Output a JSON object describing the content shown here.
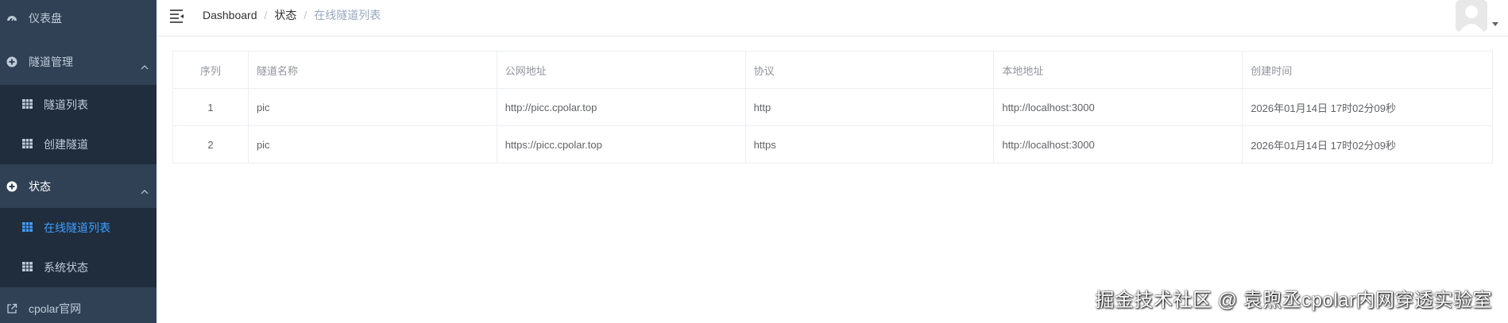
{
  "sidebar": {
    "dashboard": "仪表盘",
    "tunnel_mgmt": "隧道管理",
    "tunnel_list": "隧道列表",
    "create_tunnel": "创建隧道",
    "status": "状态",
    "online_tunnels": "在线隧道列表",
    "system_status": "系统状态",
    "official_site": "cpolar官网"
  },
  "breadcrumb": {
    "item1": "Dashboard",
    "sep": "/",
    "item2": "状态",
    "item3": "在线隧道列表"
  },
  "table": {
    "headers": [
      "序列",
      "隧道名称",
      "公网地址",
      "协议",
      "本地地址",
      "创建时间"
    ],
    "rows": [
      [
        "1",
        "pic",
        "http://picc.cpolar.top",
        "http",
        "http://localhost:3000",
        "2026年01月14日 17时02分09秒"
      ],
      [
        "2",
        "pic",
        "https://picc.cpolar.top",
        "https",
        "http://localhost:3000",
        "2026年01月14日 17时02分09秒"
      ]
    ]
  },
  "watermark": "掘金技术社区 @ 袁煦丞cpolar内网穿透实验室",
  "colors": {
    "sidebar_bg": "#304156",
    "submenu_bg": "#1f2d3d",
    "active": "#409eff"
  }
}
